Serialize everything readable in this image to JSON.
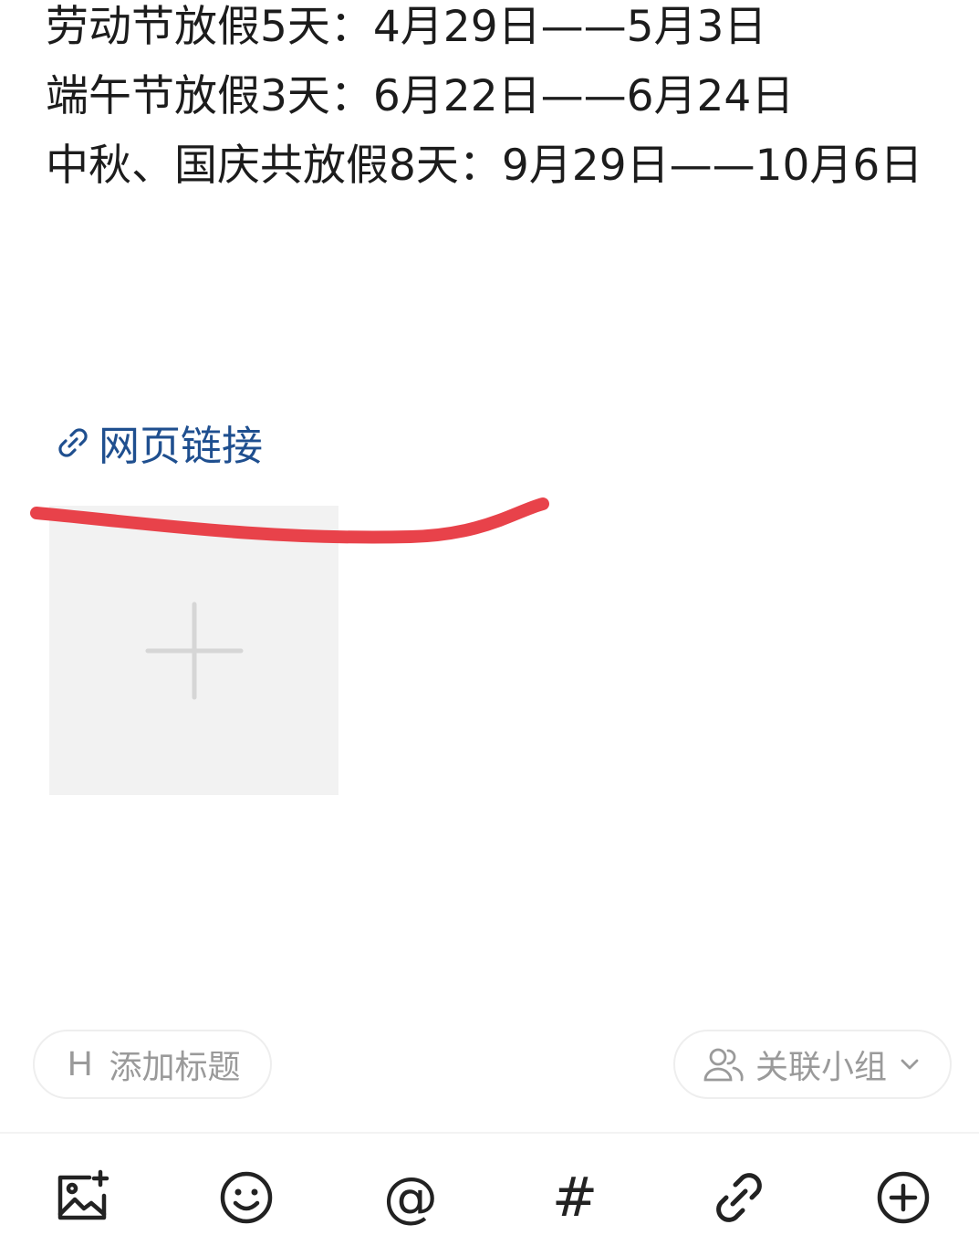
{
  "post_body": {
    "lines": [
      "劳动节放假5天：4月29日——5月3日",
      "端午节放假3天：6月22日——6月24日",
      "中秋、国庆共放假8天：9月29日——10月6日"
    ]
  },
  "web_link": {
    "label": "网页链接",
    "color": "#1f4f8f"
  },
  "annotation": {
    "red_stroke_color": "#e8424a"
  },
  "image_upload": {
    "icon": "plus-icon"
  },
  "title_button": {
    "icon": "H",
    "label": "添加标题"
  },
  "group_button": {
    "icon": "people-icon",
    "label": "关联小组",
    "dropdown_icon": "chevron-down-icon"
  },
  "toolbar": {
    "items": [
      {
        "icon": "add-image-icon"
      },
      {
        "icon": "emoji-icon"
      },
      {
        "icon": "mention-icon",
        "glyph": "@"
      },
      {
        "icon": "hashtag-icon",
        "glyph": "#"
      },
      {
        "icon": "link-icon"
      },
      {
        "icon": "more-plus-icon"
      }
    ]
  }
}
